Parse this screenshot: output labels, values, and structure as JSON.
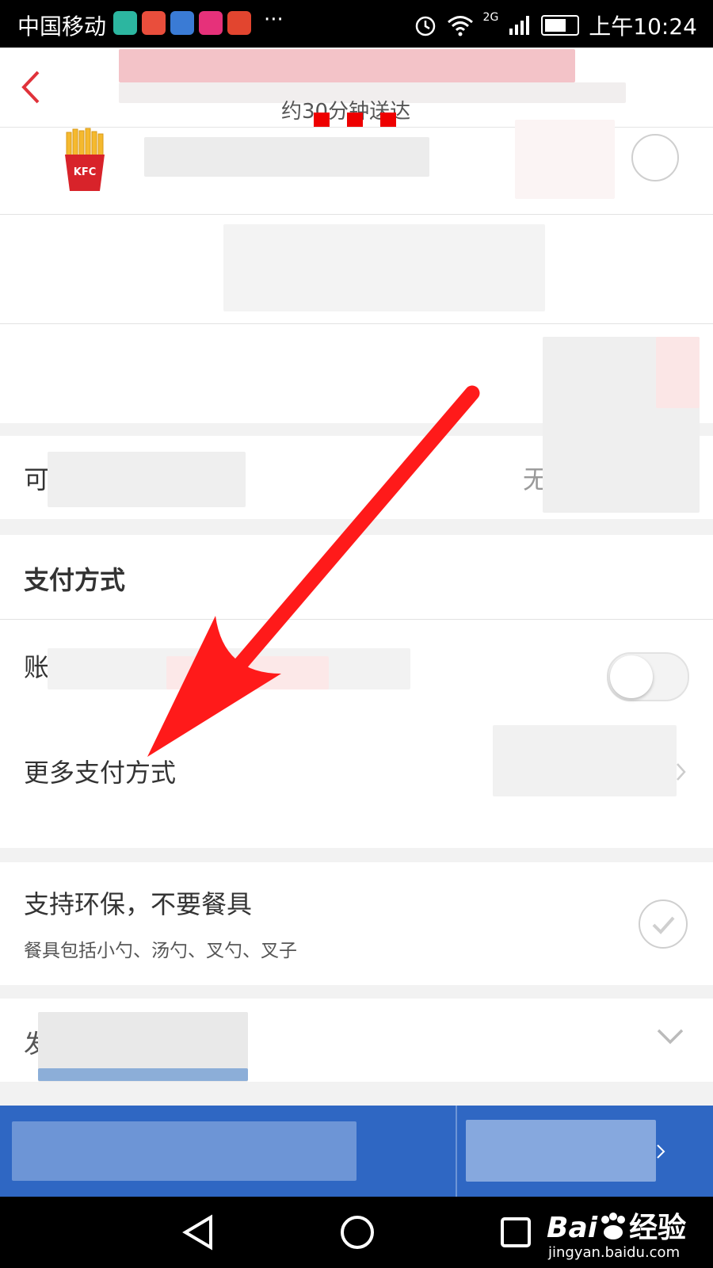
{
  "status_bar": {
    "carrier": "中国移动",
    "app_icon_colors": [
      "#2cb6a0",
      "#e94e3c",
      "#3a7bd5",
      "#e6317a",
      "#e2452f"
    ],
    "signal_label": "2G",
    "time": "上午10:24"
  },
  "header": {
    "back_icon": "chevron-left-icon",
    "subtitle": "约30分钟送达",
    "accent_color": "#e0323a"
  },
  "order": {
    "item_image": "kfc-fries-icon"
  },
  "discount": {
    "label_visible": "可",
    "value_visible": "无"
  },
  "payment": {
    "title": "支付方式",
    "account_label_visible": "账",
    "more_label": "更多支付方式",
    "more_chevron": "chevron-right-icon"
  },
  "eco": {
    "title": "支持环保，不要餐具",
    "description": "餐具包括小勺、汤勺、叉勺、叉子",
    "check_icon": "check-circle-icon"
  },
  "invoice": {
    "label_visible": "发",
    "chevron": "chevron-down-icon"
  },
  "annotation": {
    "arrow_color": "#ff1a1a"
  },
  "nav_bar": {
    "back_icon": "nav-back-icon",
    "home_icon": "nav-home-icon",
    "recent_icon": "nav-recent-icon"
  },
  "watermark": {
    "brand": "Bai",
    "brand_suffix": "经验",
    "url": "jingyan.baidu.com"
  }
}
